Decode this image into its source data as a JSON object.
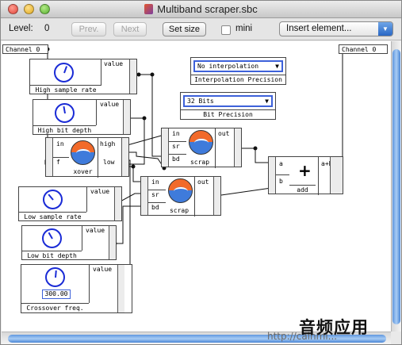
{
  "window": {
    "title": "Multiband scraper.sbc"
  },
  "toolbar": {
    "level_label": "Level:",
    "level_value": "0",
    "prev_label": "Prev.",
    "next_label": "Next",
    "set_size_label": "Set size",
    "mini_label": "mini",
    "insert_element_value": "Insert element..."
  },
  "canvas": {
    "channel_in": "Channel 0",
    "channel_out": "Channel 0",
    "modules": {
      "high_sample_rate": {
        "value_label": "value",
        "caption": "High sample rate"
      },
      "high_bit_depth": {
        "value_label": "value",
        "caption": "High bit depth"
      },
      "xover": {
        "in": "in",
        "f": "f",
        "high": "high",
        "low": "low",
        "caption": "xover"
      },
      "scrap_top": {
        "in": "in",
        "sr": "sr",
        "bd": "bd",
        "out": "out",
        "caption": "scrap"
      },
      "scrap_bottom": {
        "in": "in",
        "sr": "sr",
        "bd": "bd",
        "out": "out",
        "caption": "scrap"
      },
      "low_sample_rate": {
        "value_label": "value",
        "caption": "Low sample rate"
      },
      "low_bit_depth": {
        "value_label": "value",
        "caption": "Low bit depth"
      },
      "crossover_freq": {
        "value_label": "value",
        "display": "300.00",
        "caption": "Crossover freq."
      },
      "add": {
        "a": "a",
        "b": "b",
        "out": "a+b",
        "symbol": "+",
        "caption": "add"
      },
      "interpolation": {
        "selected": "No interpolation",
        "caption": "Interpolation Precision"
      },
      "bit_precision": {
        "selected": "32 Bits",
        "caption": "Bit Precision"
      }
    }
  },
  "watermark": {
    "text": "音频应用",
    "url": "http://cainmi..."
  }
}
